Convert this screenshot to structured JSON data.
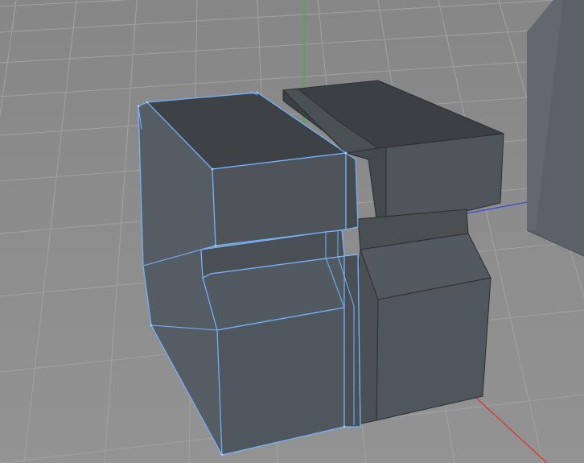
{
  "viewport": {
    "background_color": "#8c8c8c",
    "grid_color": "#a3a3a3",
    "object_face_color": "#4f555c",
    "object_top_color": "#3f4347",
    "selection_edge_color": "#74b4ff",
    "axis_colors": {
      "x": "#e0302c",
      "y": "#2fbf2f",
      "z": "#3a44e8"
    },
    "backdrop_plane_color": "#5a5e66"
  }
}
